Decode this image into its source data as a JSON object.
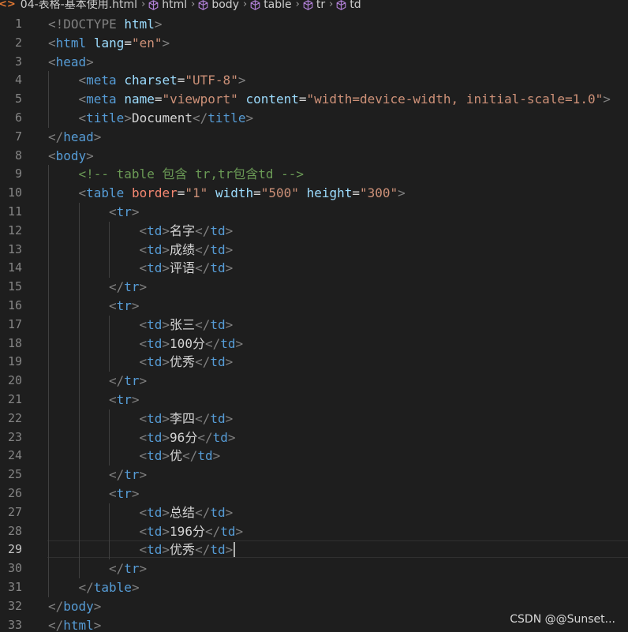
{
  "breadcrumb": {
    "file": "04-表格-基本使用.html",
    "items": [
      "html",
      "body",
      "table",
      "tr",
      "td"
    ]
  },
  "colors": {
    "background": "#1e1e1e",
    "tag": "#569cd6",
    "attribute": "#9cdcfe",
    "attribute_highlight": "#f48771",
    "string": "#ce9178",
    "comment": "#6a9955",
    "punctuation": "#808080",
    "text": "#d4d4d4"
  },
  "editor": {
    "active_line": 29,
    "lines": [
      {
        "n": "1",
        "indent": 0,
        "tokens": [
          [
            "punc",
            "<"
          ],
          [
            "punc",
            "!DOCTYPE"
          ],
          [
            "text",
            " "
          ],
          [
            "attr",
            "html"
          ],
          [
            "punc",
            ">"
          ]
        ]
      },
      {
        "n": "2",
        "indent": 0,
        "tokens": [
          [
            "punc",
            "<"
          ],
          [
            "tag",
            "html"
          ],
          [
            "text",
            " "
          ],
          [
            "attr",
            "lang"
          ],
          [
            "text",
            "="
          ],
          [
            "str",
            "\"en\""
          ],
          [
            "punc",
            ">"
          ]
        ]
      },
      {
        "n": "3",
        "indent": 0,
        "tokens": [
          [
            "punc",
            "<"
          ],
          [
            "tag",
            "head"
          ],
          [
            "punc",
            ">"
          ]
        ]
      },
      {
        "n": "4",
        "indent": 1,
        "tokens": [
          [
            "punc",
            "<"
          ],
          [
            "tag",
            "meta"
          ],
          [
            "text",
            " "
          ],
          [
            "attr",
            "charset"
          ],
          [
            "text",
            "="
          ],
          [
            "str",
            "\"UTF-8\""
          ],
          [
            "punc",
            ">"
          ]
        ]
      },
      {
        "n": "5",
        "indent": 1,
        "tokens": [
          [
            "punc",
            "<"
          ],
          [
            "tag",
            "meta"
          ],
          [
            "text",
            " "
          ],
          [
            "attr",
            "name"
          ],
          [
            "text",
            "="
          ],
          [
            "str",
            "\"viewport\""
          ],
          [
            "text",
            " "
          ],
          [
            "attr",
            "content"
          ],
          [
            "text",
            "="
          ],
          [
            "str",
            "\"width=device-width, initial-scale=1.0\""
          ],
          [
            "punc",
            ">"
          ]
        ]
      },
      {
        "n": "6",
        "indent": 1,
        "tokens": [
          [
            "punc",
            "<"
          ],
          [
            "tag",
            "title"
          ],
          [
            "punc",
            ">"
          ],
          [
            "text",
            "Document"
          ],
          [
            "punc",
            "</"
          ],
          [
            "tag",
            "title"
          ],
          [
            "punc",
            ">"
          ]
        ]
      },
      {
        "n": "7",
        "indent": 0,
        "tokens": [
          [
            "punc",
            "</"
          ],
          [
            "tag",
            "head"
          ],
          [
            "punc",
            ">"
          ]
        ]
      },
      {
        "n": "8",
        "indent": 0,
        "tokens": [
          [
            "punc",
            "<"
          ],
          [
            "tag",
            "body"
          ],
          [
            "punc",
            ">"
          ]
        ]
      },
      {
        "n": "9",
        "indent": 1,
        "tokens": [
          [
            "comment",
            "<!-- table 包含 tr,tr包含td -->"
          ]
        ]
      },
      {
        "n": "10",
        "indent": 1,
        "tokens": [
          [
            "punc",
            "<"
          ],
          [
            "tag",
            "table"
          ],
          [
            "text",
            " "
          ],
          [
            "attrred",
            "border"
          ],
          [
            "text",
            "="
          ],
          [
            "str",
            "\"1\""
          ],
          [
            "text",
            " "
          ],
          [
            "attr",
            "width"
          ],
          [
            "text",
            "="
          ],
          [
            "str",
            "\"500\""
          ],
          [
            "text",
            " "
          ],
          [
            "attr",
            "height"
          ],
          [
            "text",
            "="
          ],
          [
            "str",
            "\"300\""
          ],
          [
            "punc",
            ">"
          ]
        ]
      },
      {
        "n": "11",
        "indent": 2,
        "tokens": [
          [
            "punc",
            "<"
          ],
          [
            "tag",
            "tr"
          ],
          [
            "punc",
            ">"
          ]
        ]
      },
      {
        "n": "12",
        "indent": 3,
        "tokens": [
          [
            "punc",
            "<"
          ],
          [
            "tag",
            "td"
          ],
          [
            "punc",
            ">"
          ],
          [
            "text",
            "名字"
          ],
          [
            "punc",
            "</"
          ],
          [
            "tag",
            "td"
          ],
          [
            "punc",
            ">"
          ]
        ]
      },
      {
        "n": "13",
        "indent": 3,
        "tokens": [
          [
            "punc",
            "<"
          ],
          [
            "tag",
            "td"
          ],
          [
            "punc",
            ">"
          ],
          [
            "text",
            "成绩"
          ],
          [
            "punc",
            "</"
          ],
          [
            "tag",
            "td"
          ],
          [
            "punc",
            ">"
          ]
        ]
      },
      {
        "n": "14",
        "indent": 3,
        "tokens": [
          [
            "punc",
            "<"
          ],
          [
            "tag",
            "td"
          ],
          [
            "punc",
            ">"
          ],
          [
            "text",
            "评语"
          ],
          [
            "punc",
            "</"
          ],
          [
            "tag",
            "td"
          ],
          [
            "punc",
            ">"
          ]
        ]
      },
      {
        "n": "15",
        "indent": 2,
        "tokens": [
          [
            "punc",
            "</"
          ],
          [
            "tag",
            "tr"
          ],
          [
            "punc",
            ">"
          ]
        ]
      },
      {
        "n": "16",
        "indent": 2,
        "tokens": [
          [
            "punc",
            "<"
          ],
          [
            "tag",
            "tr"
          ],
          [
            "punc",
            ">"
          ]
        ]
      },
      {
        "n": "17",
        "indent": 3,
        "tokens": [
          [
            "punc",
            "<"
          ],
          [
            "tag",
            "td"
          ],
          [
            "punc",
            ">"
          ],
          [
            "text",
            "张三"
          ],
          [
            "punc",
            "</"
          ],
          [
            "tag",
            "td"
          ],
          [
            "punc",
            ">"
          ]
        ]
      },
      {
        "n": "18",
        "indent": 3,
        "tokens": [
          [
            "punc",
            "<"
          ],
          [
            "tag",
            "td"
          ],
          [
            "punc",
            ">"
          ],
          [
            "text",
            "100分"
          ],
          [
            "punc",
            "</"
          ],
          [
            "tag",
            "td"
          ],
          [
            "punc",
            ">"
          ]
        ]
      },
      {
        "n": "19",
        "indent": 3,
        "tokens": [
          [
            "punc",
            "<"
          ],
          [
            "tag",
            "td"
          ],
          [
            "punc",
            ">"
          ],
          [
            "text",
            "优秀"
          ],
          [
            "punc",
            "</"
          ],
          [
            "tag",
            "td"
          ],
          [
            "punc",
            ">"
          ]
        ]
      },
      {
        "n": "20",
        "indent": 2,
        "tokens": [
          [
            "punc",
            "</"
          ],
          [
            "tag",
            "tr"
          ],
          [
            "punc",
            ">"
          ]
        ]
      },
      {
        "n": "21",
        "indent": 2,
        "tokens": [
          [
            "punc",
            "<"
          ],
          [
            "tag",
            "tr"
          ],
          [
            "punc",
            ">"
          ]
        ]
      },
      {
        "n": "22",
        "indent": 3,
        "tokens": [
          [
            "punc",
            "<"
          ],
          [
            "tag",
            "td"
          ],
          [
            "punc",
            ">"
          ],
          [
            "text",
            "李四"
          ],
          [
            "punc",
            "</"
          ],
          [
            "tag",
            "td"
          ],
          [
            "punc",
            ">"
          ]
        ]
      },
      {
        "n": "23",
        "indent": 3,
        "tokens": [
          [
            "punc",
            "<"
          ],
          [
            "tag",
            "td"
          ],
          [
            "punc",
            ">"
          ],
          [
            "text",
            "96分"
          ],
          [
            "punc",
            "</"
          ],
          [
            "tag",
            "td"
          ],
          [
            "punc",
            ">"
          ]
        ]
      },
      {
        "n": "24",
        "indent": 3,
        "tokens": [
          [
            "punc",
            "<"
          ],
          [
            "tag",
            "td"
          ],
          [
            "punc",
            ">"
          ],
          [
            "text",
            "优"
          ],
          [
            "punc",
            "</"
          ],
          [
            "tag",
            "td"
          ],
          [
            "punc",
            ">"
          ]
        ]
      },
      {
        "n": "25",
        "indent": 2,
        "tokens": [
          [
            "punc",
            "</"
          ],
          [
            "tag",
            "tr"
          ],
          [
            "punc",
            ">"
          ]
        ]
      },
      {
        "n": "26",
        "indent": 2,
        "tokens": [
          [
            "punc",
            "<"
          ],
          [
            "tag",
            "tr"
          ],
          [
            "punc",
            ">"
          ]
        ]
      },
      {
        "n": "27",
        "indent": 3,
        "tokens": [
          [
            "punc",
            "<"
          ],
          [
            "tag",
            "td"
          ],
          [
            "punc",
            ">"
          ],
          [
            "text",
            "总结"
          ],
          [
            "punc",
            "</"
          ],
          [
            "tag",
            "td"
          ],
          [
            "punc",
            ">"
          ]
        ]
      },
      {
        "n": "28",
        "indent": 3,
        "tokens": [
          [
            "punc",
            "<"
          ],
          [
            "tag",
            "td"
          ],
          [
            "punc",
            ">"
          ],
          [
            "text",
            "196分"
          ],
          [
            "punc",
            "</"
          ],
          [
            "tag",
            "td"
          ],
          [
            "punc",
            ">"
          ]
        ]
      },
      {
        "n": "29",
        "indent": 3,
        "tokens": [
          [
            "punc",
            "<"
          ],
          [
            "tag",
            "td"
          ],
          [
            "punc",
            ">"
          ],
          [
            "text",
            "优秀"
          ],
          [
            "punc",
            "</"
          ],
          [
            "tag",
            "td"
          ],
          [
            "punc",
            ">"
          ]
        ]
      },
      {
        "n": "30",
        "indent": 2,
        "tokens": [
          [
            "punc",
            "</"
          ],
          [
            "tag",
            "tr"
          ],
          [
            "punc",
            ">"
          ]
        ]
      },
      {
        "n": "31",
        "indent": 1,
        "tokens": [
          [
            "punc",
            "</"
          ],
          [
            "tag",
            "table"
          ],
          [
            "punc",
            ">"
          ]
        ]
      },
      {
        "n": "32",
        "indent": 0,
        "tokens": [
          [
            "punc",
            "</"
          ],
          [
            "tag",
            "body"
          ],
          [
            "punc",
            ">"
          ]
        ]
      },
      {
        "n": "33",
        "indent": 0,
        "tokens": [
          [
            "punc",
            "</"
          ],
          [
            "tag",
            "html"
          ],
          [
            "punc",
            ">"
          ]
        ]
      }
    ]
  },
  "watermark": "CSDN @@Sunset..."
}
